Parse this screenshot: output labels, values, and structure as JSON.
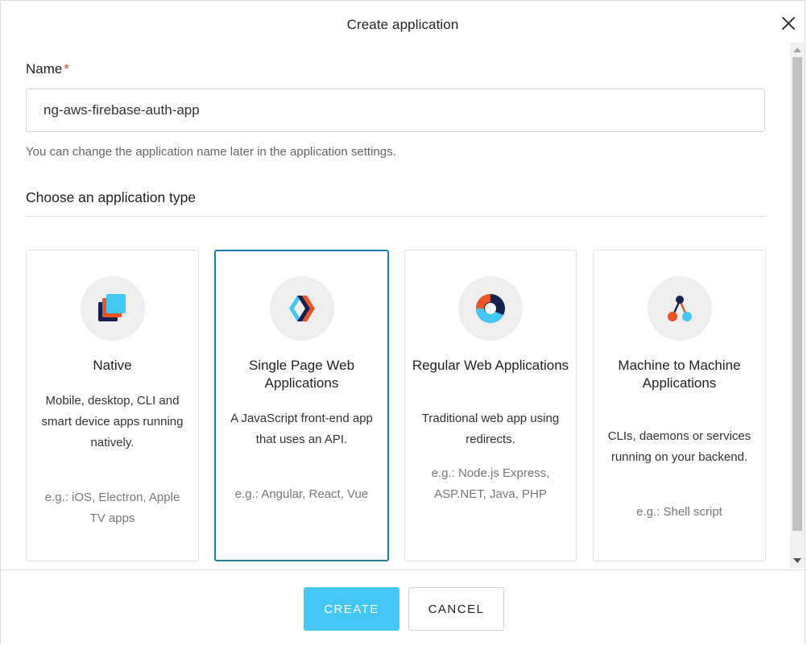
{
  "dialog": {
    "title": "Create application"
  },
  "form": {
    "name_label": "Name",
    "required_marker": "*",
    "name_value": "ng-aws-firebase-auth-app",
    "name_help": "You can change the application name later in the application settings.",
    "type_heading": "Choose an application type"
  },
  "cards": [
    {
      "title": "Native",
      "description": "Mobile, desktop, CLI and smart device apps running natively.",
      "example": "e.g.: iOS, Electron, Apple TV apps",
      "icon": "native-app-icon"
    },
    {
      "title": "Single Page Web Applications",
      "description": "A JavaScript front-end app that uses an API.",
      "example": "e.g.: Angular, React, Vue",
      "icon": "spa-icon",
      "selected": true
    },
    {
      "title": "Regular Web Applications",
      "description": "Traditional web app using redirects.",
      "example": "e.g.: Node.js Express, ASP.NET, Java, PHP",
      "icon": "regular-web-app-icon"
    },
    {
      "title": "Machine to Machine Applications",
      "description": "CLIs, daemons or services running on your backend.",
      "example": "e.g.: Shell script",
      "icon": "machine-to-machine-icon"
    }
  ],
  "footer": {
    "create_label": "CREATE",
    "cancel_label": "CANCEL"
  },
  "colors": {
    "accent": "#44c7f4",
    "selected_border": "#1f7da8",
    "required": "#e0493a",
    "icon_orange": "#eb5424",
    "icon_navy": "#16214d",
    "icon_blue": "#44c7f4"
  }
}
